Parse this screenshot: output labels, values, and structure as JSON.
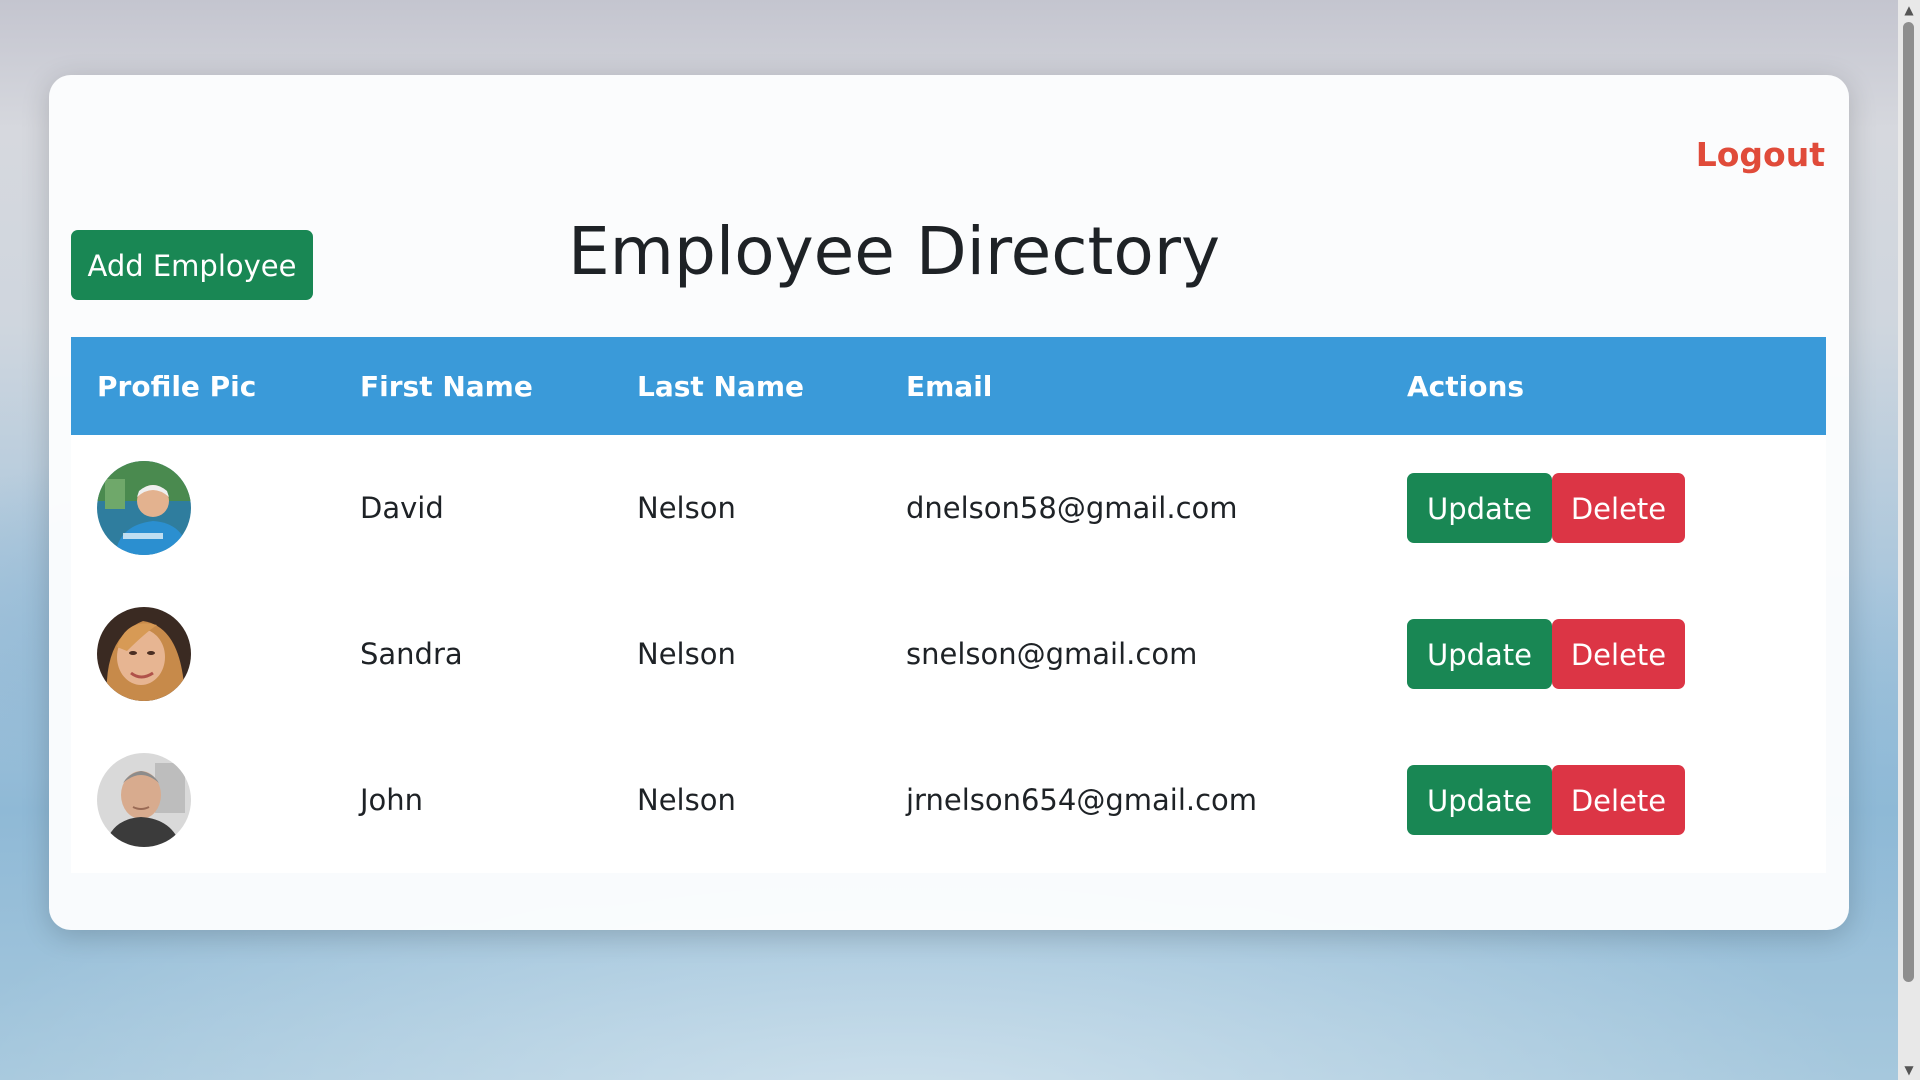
{
  "header": {
    "title": "Employee Directory",
    "logout_label": "Logout",
    "add_label": "Add Employee"
  },
  "table": {
    "columns": [
      "Profile Pic",
      "First Name",
      "Last Name",
      "Email",
      "Actions"
    ],
    "rows": [
      {
        "first_name": "David",
        "last_name": "Nelson",
        "email": "dnelson58@gmail.com",
        "update_label": "Update",
        "delete_label": "Delete"
      },
      {
        "first_name": "Sandra",
        "last_name": "Nelson",
        "email": "snelson@gmail.com",
        "update_label": "Update",
        "delete_label": "Delete"
      },
      {
        "first_name": "John",
        "last_name": "Nelson",
        "email": "jrnelson654@gmail.com",
        "update_label": "Update",
        "delete_label": "Delete"
      }
    ]
  },
  "colors": {
    "header_bg": "#3a9ad9",
    "primary_green": "#198754",
    "danger_red": "#dc3545",
    "logout_red": "#e04b3a"
  }
}
